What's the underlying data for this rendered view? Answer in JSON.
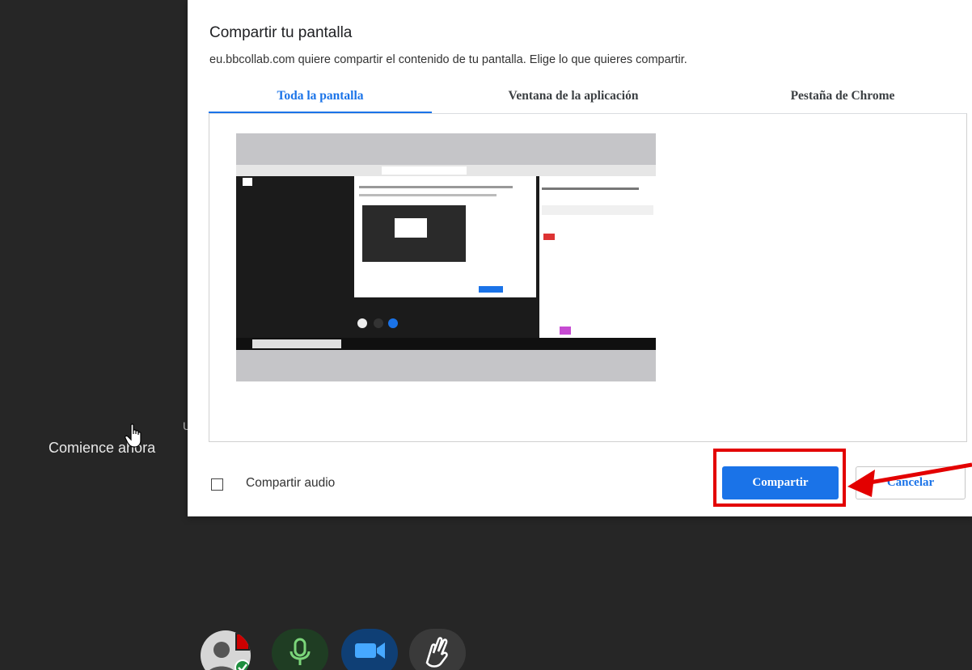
{
  "background": {
    "start_label": "Comience ahora",
    "partial_letter": "U"
  },
  "dialog": {
    "title": "Compartir tu pantalla",
    "description": "eu.bbcollab.com quiere compartir el contenido de tu pantalla. Elige lo que quieres compartir.",
    "tabs": [
      {
        "label": "Toda la pantalla",
        "active": true
      },
      {
        "label": "Ventana de la aplicación",
        "active": false
      },
      {
        "label": "Pestaña de Chrome",
        "active": false
      }
    ],
    "audio_label": "Compartir audio",
    "share_label": "Compartir",
    "cancel_label": "Cancelar"
  },
  "colors": {
    "accent": "#1a73e8",
    "highlight": "#e30000",
    "background": "#262626"
  },
  "controls": {
    "icons": [
      "avatar-status-icon",
      "microphone-icon",
      "camera-icon",
      "raise-hand-icon"
    ]
  }
}
